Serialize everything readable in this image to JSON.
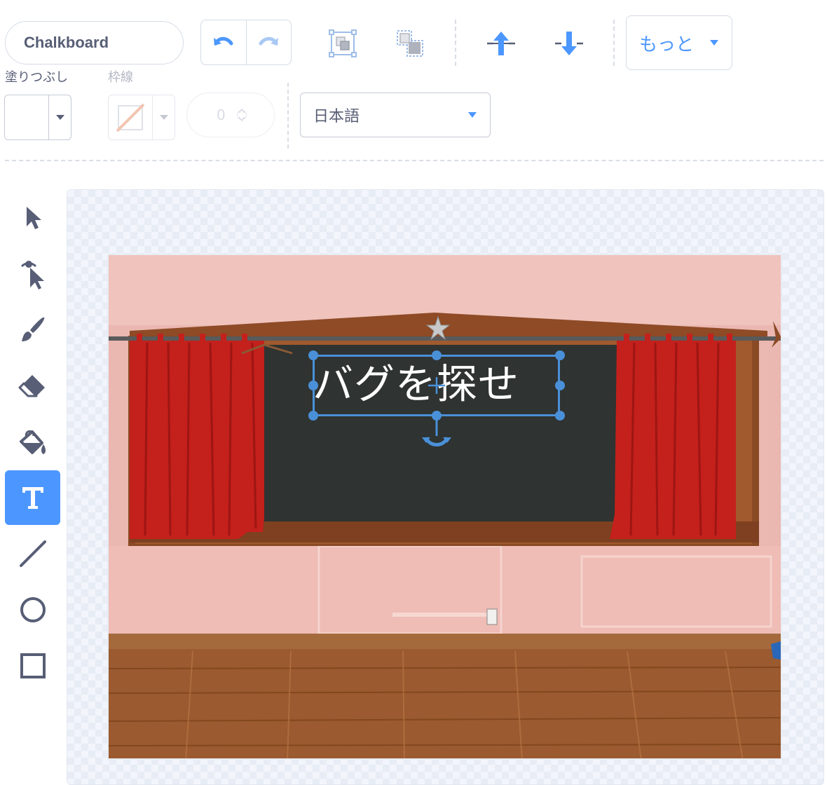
{
  "costume": {
    "name": "Chalkboard"
  },
  "toolbar": {
    "undo_icon": "undo-icon",
    "redo_icon": "redo-icon",
    "group_icon": "group-icon",
    "ungroup_icon": "ungroup-icon",
    "forward_icon": "forward-icon",
    "backward_icon": "backward-icon",
    "more_label": "もっと"
  },
  "fill": {
    "label": "塗りつぶし",
    "color": "#ffffff"
  },
  "outline": {
    "label": "枠線",
    "width_value": "0"
  },
  "font": {
    "selected": "日本語"
  },
  "tools": [
    {
      "name": "select",
      "icon": "arrow-select-icon"
    },
    {
      "name": "reshape",
      "icon": "reshape-icon"
    },
    {
      "name": "brush",
      "icon": "brush-icon"
    },
    {
      "name": "eraser",
      "icon": "eraser-icon"
    },
    {
      "name": "fill",
      "icon": "paint-bucket-icon"
    },
    {
      "name": "text",
      "icon": "text-icon",
      "active": true
    },
    {
      "name": "line",
      "icon": "line-icon"
    },
    {
      "name": "circle",
      "icon": "circle-icon"
    },
    {
      "name": "rectangle",
      "icon": "rectangle-icon"
    }
  ],
  "canvas": {
    "text": "バグを探せ"
  },
  "colors": {
    "accent": "#4c97ff",
    "text_gray": "#575e75",
    "curtain": "#c4201c",
    "board": "#2b2f2d",
    "wall": "#eab6b0",
    "floor": "#9a5a2e"
  }
}
